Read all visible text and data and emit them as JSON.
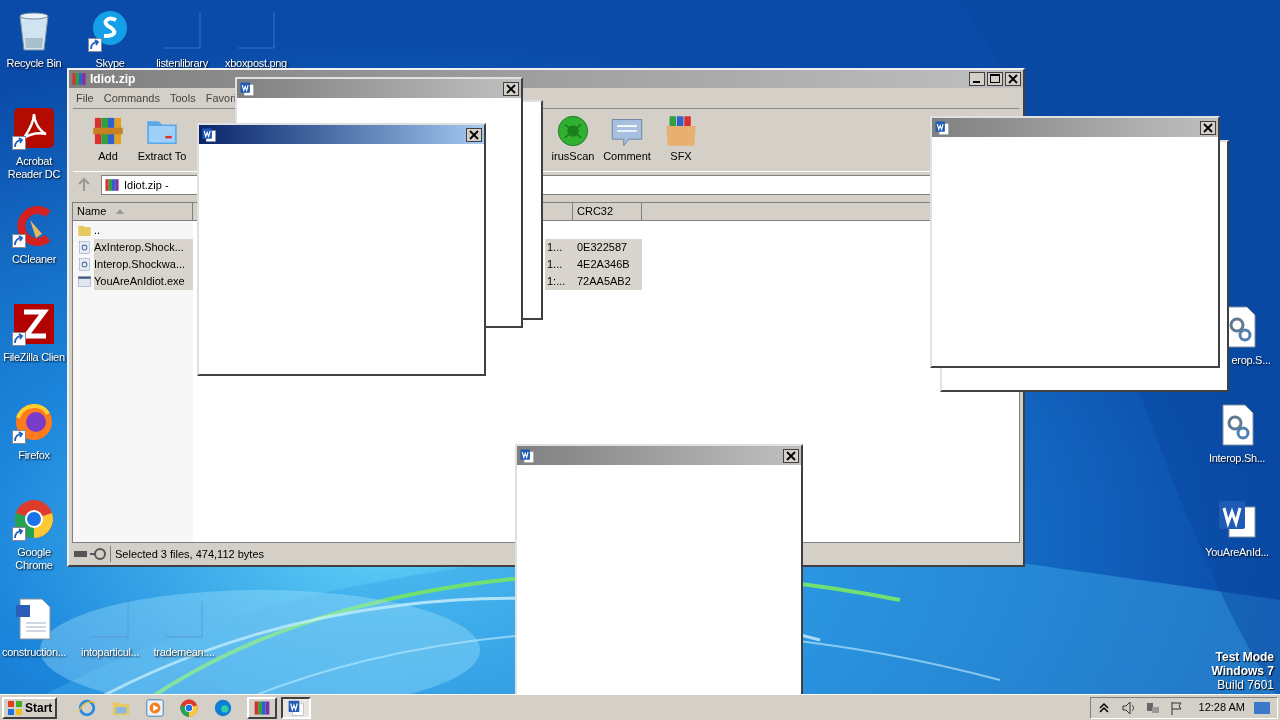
{
  "desktop": {
    "left_column": [
      {
        "label": "Recycle Bin",
        "kind": "recycle",
        "shortcut": false
      },
      {
        "label": "Acrobat Reader DC",
        "kind": "acrobat",
        "shortcut": true
      },
      {
        "label": "CCleaner",
        "kind": "ccleaner",
        "shortcut": true
      },
      {
        "label": "FileZilla Clien",
        "kind": "filezilla",
        "shortcut": true
      },
      {
        "label": "Firefox",
        "kind": "firefox",
        "shortcut": true
      },
      {
        "label": "Google Chrome",
        "kind": "chrome",
        "shortcut": true
      },
      {
        "label": "construction...",
        "kind": "document",
        "shortcut": false
      }
    ],
    "top_row": [
      {
        "label": "Skype",
        "kind": "skype",
        "shortcut": true
      },
      {
        "label": "listenlibrary",
        "kind": "blank",
        "shortcut": false
      },
      {
        "label": "xboxpost.png",
        "kind": "blank",
        "shortcut": false
      }
    ],
    "bottom_row": [
      {
        "label": "intoparticul...",
        "kind": "blank",
        "shortcut": false
      },
      {
        "label": "trademean....",
        "kind": "blank",
        "shortcut": false
      }
    ],
    "right_column": [
      {
        "label": "erop.S...",
        "kind": "settings",
        "shortcut": false
      },
      {
        "label": "Interop.Sh...",
        "kind": "settings",
        "shortcut": false
      },
      {
        "label": "YouAreAnId...",
        "kind": "word",
        "shortcut": false
      }
    ],
    "system_info": [
      "Test Mode",
      "Windows 7",
      "Build 7601"
    ]
  },
  "archive_window": {
    "title": "Idiot.zip",
    "active": false,
    "menu": [
      "File",
      "Commands",
      "Tools",
      "Favori"
    ],
    "toolbar": {
      "left": [
        {
          "label": "Add",
          "kind": "add"
        },
        {
          "label": "Extract To",
          "kind": "extract"
        }
      ],
      "right": [
        {
          "label": "irusScan",
          "kind": "scan"
        },
        {
          "label": "Comment",
          "kind": "comment"
        },
        {
          "label": "SFX",
          "kind": "sfx"
        }
      ]
    },
    "address": "Idiot.zip -",
    "columns": [
      "Name",
      "CRC32"
    ],
    "rows": [
      {
        "name": "..",
        "kind": "folder",
        "selected": false
      },
      {
        "name": "AxInterop.Shock...",
        "kind": "library",
        "column_2": "1...",
        "crc32": "0E322587",
        "selected": true
      },
      {
        "name": "Interop.Shockwa...",
        "kind": "library",
        "column_2": "1...",
        "crc32": "4E2A346B",
        "selected": true
      },
      {
        "name": "YouAreAnIdiot.exe",
        "kind": "program",
        "column_2": "1:...",
        "crc32": "72AA5AB2",
        "selected": true
      }
    ],
    "status": "Selected 3 files, 474,112 bytes"
  },
  "popups": [
    {
      "kind": "frame"
    },
    {
      "kind": "window",
      "active": false
    },
    {
      "kind": "window",
      "active": true
    },
    {
      "kind": "frame"
    },
    {
      "kind": "window",
      "active": false
    },
    {
      "kind": "window",
      "active": false
    }
  ],
  "taskbar": {
    "start": "Start",
    "quick_launch": [
      {
        "kind": "ie"
      },
      {
        "kind": "explorer"
      },
      {
        "kind": "media"
      },
      {
        "kind": "chrome"
      },
      {
        "kind": "edge"
      }
    ],
    "tasks": [
      {
        "kind": "winrar",
        "selected": false
      },
      {
        "kind": "word",
        "selected": true
      }
    ],
    "tray": [
      {
        "kind": "chevron"
      },
      {
        "kind": "volume"
      },
      {
        "kind": "network"
      },
      {
        "kind": "flag"
      }
    ],
    "clock": "12:28 AM"
  }
}
